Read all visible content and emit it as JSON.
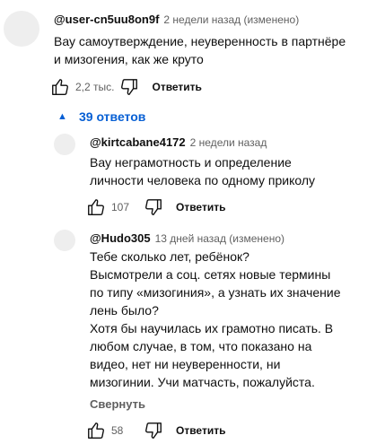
{
  "comments": [
    {
      "author": "@user-cn5uu8on9f",
      "meta": "2 недели назад (изменено)",
      "lines": [
        "Вау самоутверждение, неуверенность в партнёре",
        "и мизогения, как же круто"
      ],
      "likes": "2,2 тыс.",
      "reply_label": "Ответить"
    }
  ],
  "replies_toggle": {
    "label": "39 ответов",
    "icon": "caret-up-icon"
  },
  "replies": [
    {
      "author": "@kirtcabane4172",
      "meta": "2 недели назад",
      "lines": [
        "Вау неграмотность и определение",
        "личности человека по одному приколу"
      ],
      "likes": "107",
      "reply_label": "Ответить"
    },
    {
      "author": "@Hudo305",
      "meta": "13 дней назад (изменено)",
      "lines": [
        "Тебе сколько лет, ребёнок?",
        "Высмотрели а соц. сетях новые термины",
        "по типу «мизогиния», а узнать их значение",
        "лень было?",
        "Хотя бы научилась их грамотно писать. В",
        "любом случае, в том, что показано на",
        "видео, нет ни неуверенности, ни",
        "мизогинии. Учи матчасть, пожалуйста."
      ],
      "collapse_label": "Свернуть",
      "likes": "58",
      "reply_label": "Ответить"
    }
  ],
  "icons": {
    "like": "thumbs-up-icon",
    "dislike": "thumbs-down-icon"
  },
  "colors": {
    "link_blue": "#065fd4",
    "meta_gray": "#606060",
    "avatar_gray": "#eeeeee"
  }
}
